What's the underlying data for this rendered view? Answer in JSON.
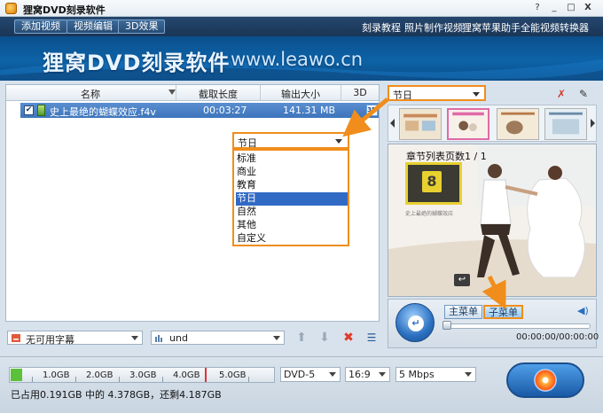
{
  "app": {
    "title": "狸窝DVD刻录软件",
    "window_buttons": [
      "?",
      "_",
      "□",
      "X"
    ]
  },
  "toolbar": {
    "buttons": [
      "添加视频",
      "视频编辑",
      "3D效果"
    ],
    "links": [
      "刻录教程",
      "照片制作视频",
      "狸窝苹果助手",
      "全能视频转换器"
    ]
  },
  "banner": {
    "title": "狸窝DVD刻录软件",
    "url": "www.leawo.cn"
  },
  "file_list": {
    "columns": [
      "名称",
      "截取长度",
      "输出大小",
      "3D"
    ],
    "rows": [
      {
        "name": "史上最绝的蝴蝶效应.f4v",
        "duration": "00:03:27",
        "size": "141.31 MB",
        "badge": "3D"
      }
    ]
  },
  "category_dropdown": {
    "selected": "节日",
    "options": [
      "标准",
      "商业",
      "教育",
      "节日",
      "自然",
      "其他",
      "自定义"
    ],
    "highlighted_index": 3
  },
  "subtitle_bar": {
    "subtitle_value": "无可用字幕",
    "audio_value": "und"
  },
  "menu_panel": {
    "template_category": "节日",
    "preview_title": "章节列表页数1 / 1",
    "chapter_number": "8",
    "chapter_caption": "史上最绝的蝴蝶效应",
    "tabs": [
      "主菜单",
      "子菜单"
    ],
    "active_tab": "子菜单",
    "time": "00:00:00/00:00:00"
  },
  "capacity": {
    "ticks": [
      "1.0GB",
      "2.0GB",
      "3.0GB",
      "4.0GB",
      "5.0GB"
    ],
    "used_fraction": 0.044,
    "usage_text": "已占用0.191GB 中的 4.378GB，还剩4.187GB"
  },
  "output_settings": {
    "disc_type": "DVD-5",
    "aspect": "16:9",
    "bitrate": "5 Mbps"
  },
  "colors": {
    "highlight_orange": "#f08d1c",
    "selection_blue": "#316ac5",
    "banner_blue": "#0d63a8"
  }
}
